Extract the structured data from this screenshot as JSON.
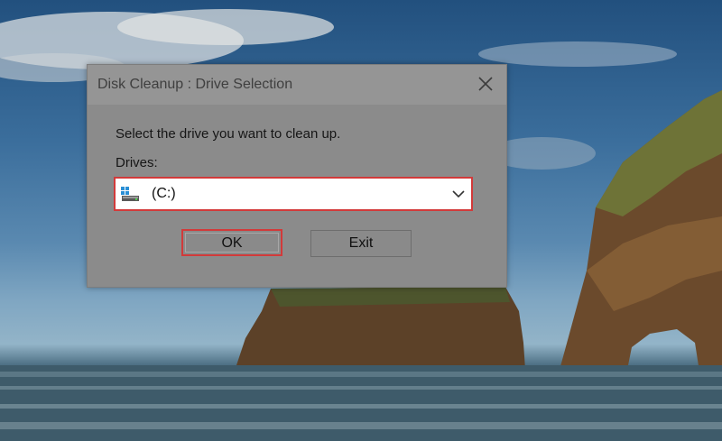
{
  "dialog": {
    "title": "Disk Cleanup : Drive Selection",
    "instruction": "Select the drive you want to clean up.",
    "drives_label": "Drives:",
    "selected_drive": "(C:)",
    "ok_label": "OK",
    "exit_label": "Exit"
  },
  "icons": {
    "close": "close-icon",
    "drive": "hard-drive-icon",
    "dropdown": "chevron-down-icon"
  },
  "colors": {
    "highlight": "#d23a3a",
    "dialog_background": "#8b8b8b"
  }
}
